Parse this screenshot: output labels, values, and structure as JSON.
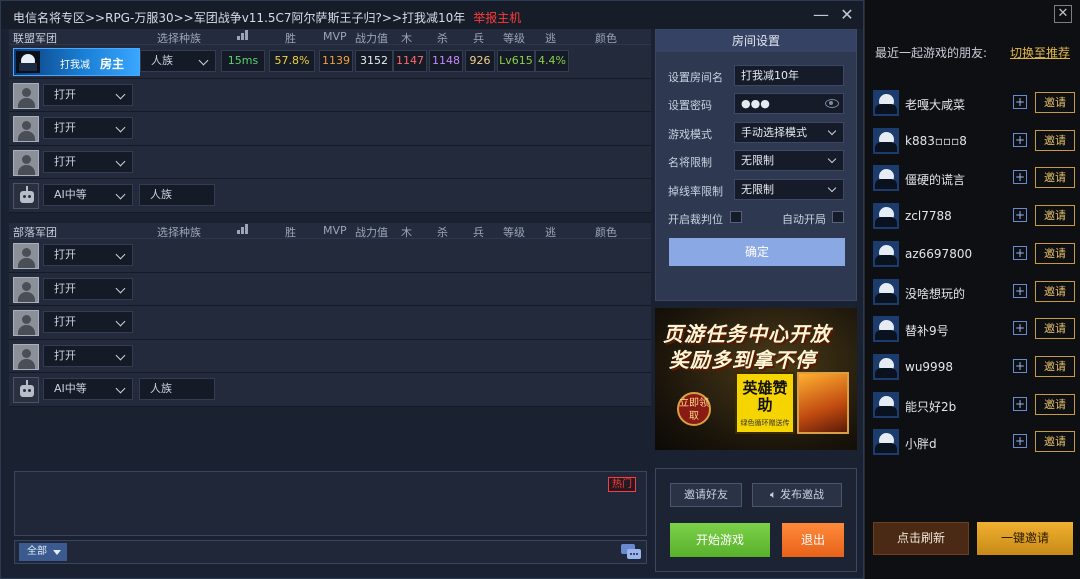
{
  "title": {
    "path": "电信名将专区>>RPG-万服30>>军团战争v11.5C7阿尔萨斯王子归?>>打我减10年",
    "report": "举报主机"
  },
  "columns": [
    "选择种族",
    "胜",
    "MVP",
    "战力值",
    "木",
    "杀",
    "兵",
    "等级",
    "逃",
    "颜色"
  ],
  "alliance": {
    "name": "联盟军团",
    "host": {
      "name": "打我减",
      "role": "房主",
      "race": "人族",
      "ping": "15ms",
      "win": "57.8%",
      "mvp": "1139",
      "power": "3152",
      "wood": "1147",
      "kill": "1148",
      "soldier": "926",
      "level": "Lv615",
      "escape": "4.4%"
    },
    "open_slots": [
      "打开",
      "打开",
      "打开"
    ],
    "ai": {
      "difficulty": "AI中等",
      "race": "人族"
    }
  },
  "horde": {
    "name": "部落军团",
    "open_slots": [
      "打开",
      "打开",
      "打开",
      "打开"
    ],
    "ai": {
      "difficulty": "AI中等",
      "race": "人族"
    }
  },
  "settings": {
    "header": "房间设置",
    "room_name_label": "设置房间名",
    "room_name": "打我减10年",
    "password_label": "设置密码",
    "password": "●●●",
    "mode_label": "游戏模式",
    "mode": "手动选择模式",
    "hero_limit_label": "名将限制",
    "hero_limit": "无限制",
    "disconnect_label": "掉线率限制",
    "disconnect": "无限制",
    "referee_label": "开启裁判位",
    "autostart_label": "自动开局",
    "confirm": "确定"
  },
  "ad": {
    "line1": "页游任务中心开放",
    "line2": "奖励多到拿不停",
    "claim": "立即领取",
    "card_title": "英雄赞助",
    "card_sub": "绿色循环赠送传"
  },
  "actions": {
    "invite": "邀请好友",
    "broadcast": "发布邀战",
    "start": "开始游戏",
    "quit": "退出"
  },
  "chat": {
    "hot": "热门",
    "channel": "全部"
  },
  "friends": {
    "header": "最近一起游戏的朋友:",
    "switch": "切换至推荐",
    "invite_label": "邀请",
    "list": [
      "老嘎大咸菜",
      "k883▫▫▫8",
      "僵硬的谎言",
      "zcl7788",
      "az6697800",
      "没啥想玩的",
      "替补9号",
      "wu9998",
      "能只好2b",
      "小胖d"
    ],
    "refresh": "点击刷新",
    "invite_all": "一键邀请"
  },
  "colors": {
    "ping": "#5ed06a",
    "win": "#f0d040",
    "mvp": "#f0a040",
    "power": "#e8ecf2",
    "wood": "#ff6a6a",
    "kill": "#c888ff",
    "soldier": "#f0d090",
    "level": "#8ad04a",
    "escape": "#8ad04a"
  }
}
